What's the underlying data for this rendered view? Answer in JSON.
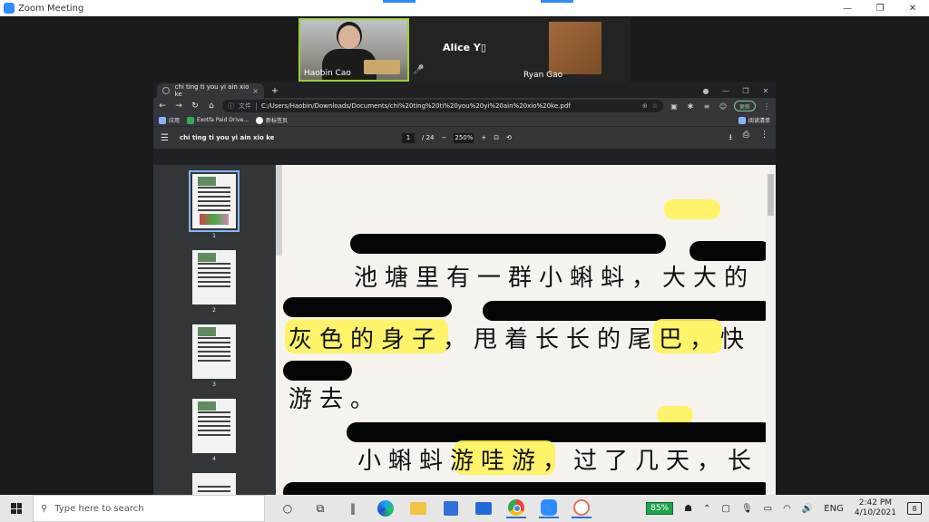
{
  "zoom": {
    "window_title": "Zoom Meeting",
    "controls": {
      "minimize": "—",
      "restore": "❐",
      "close": "✕"
    },
    "participants": [
      {
        "name": "Haobin Cao",
        "video": true,
        "active_speaker": true
      },
      {
        "name": "Alice Y▯",
        "video": false
      },
      {
        "name": "Ryan Gao",
        "video": false
      }
    ]
  },
  "browser": {
    "tab_title": "chi ting ti you yi ain xio ke",
    "tab_close": "×",
    "new_tab": "+",
    "address_scheme_label": "文件",
    "address_url": "C:/Users/Haobin/Downloads/Documents/chi%20ting%20ti%20you%20yi%20ain%20xio%20ke.pdf",
    "update_button": "更新",
    "bookmarks": [
      {
        "label": "应用"
      },
      {
        "label": "Exotfa Paid Drive..."
      },
      {
        "label": "新标签页"
      }
    ],
    "reading_list": "阅读清单"
  },
  "pdf": {
    "title": "chi ting ti you yi ain xio ke",
    "current_page": "1",
    "total_pages": "/ 24",
    "zoom": "250%",
    "thumbnails": [
      "1",
      "2",
      "3",
      "4"
    ],
    "lines": [
      "池塘里有一群小蝌蚪，大大的",
      "灰色的身子，甩着长长的尾巴，快",
      "游去。",
      "小蝌蚪游哇游，过了几天，长"
    ]
  },
  "taskbar": {
    "search_placeholder": "Type here to search",
    "battery": "85%",
    "language": "ENG",
    "time": "2:42 PM",
    "date": "4/10/2021",
    "notification_count": "8"
  }
}
